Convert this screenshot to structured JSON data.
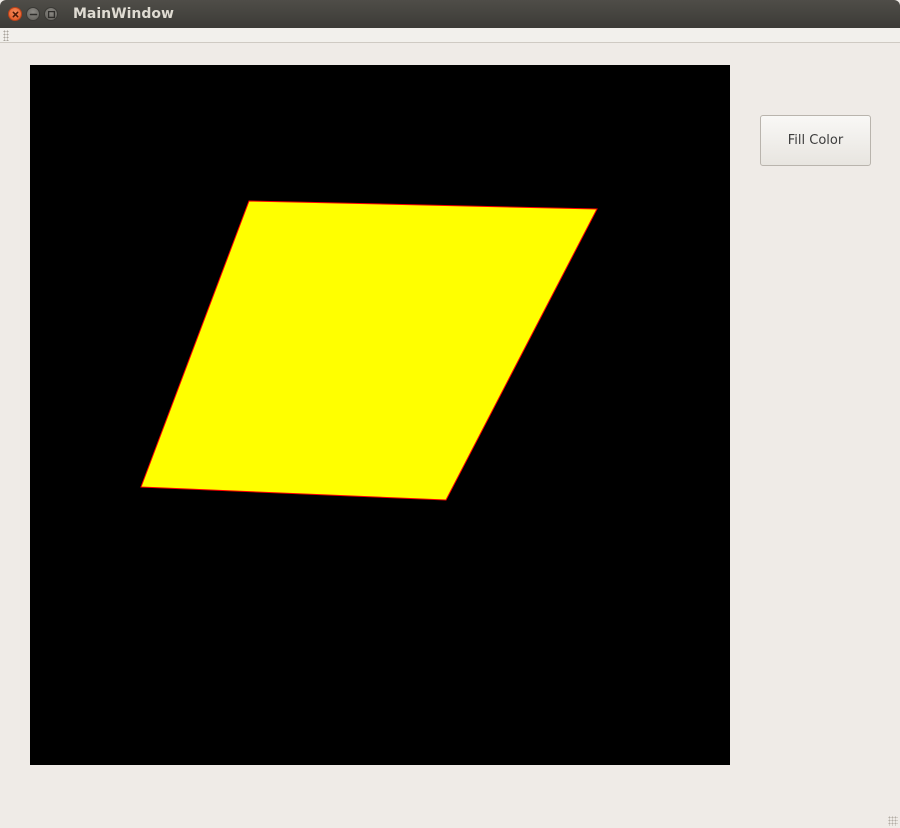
{
  "window": {
    "title": "MainWindow"
  },
  "controls": {
    "close_icon": "close-icon",
    "minimize_icon": "minimize-icon",
    "maximize_icon": "maximize-icon"
  },
  "canvas": {
    "background_color": "#000000",
    "shape": {
      "type": "quadrilateral",
      "fill_color": "#ffff00",
      "outline_color": "#ff0000"
    }
  },
  "actions": {
    "fill_color_label": "Fill Color"
  }
}
